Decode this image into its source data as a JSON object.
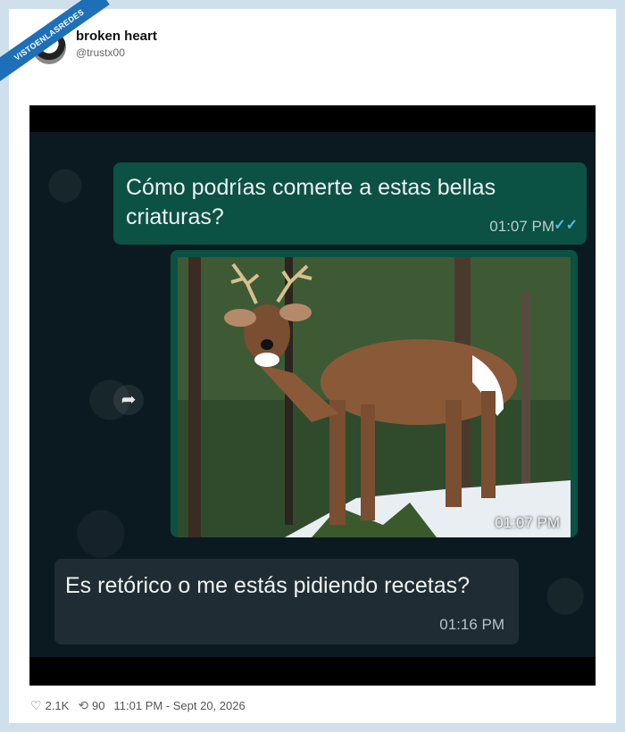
{
  "watermark": "VISTOENLASREDES",
  "author": {
    "name": "broken heart",
    "handle": "@trustx00"
  },
  "chat": {
    "outgoing": {
      "text": "Cómo podrías comerte a estas bellas criaturas?",
      "time": "01:07 PM",
      "ticks": "✓✓"
    },
    "image": {
      "time": "01:07 PM",
      "alt_icon": "deer-photo"
    },
    "incoming": {
      "text": "Es retórico o me estás pidiendo recetas?",
      "time": "01:16 PM"
    }
  },
  "footer": {
    "likes": "2.1K",
    "retweets": "90",
    "timestamp": "11:01 PM - Sept 20, 2026"
  }
}
